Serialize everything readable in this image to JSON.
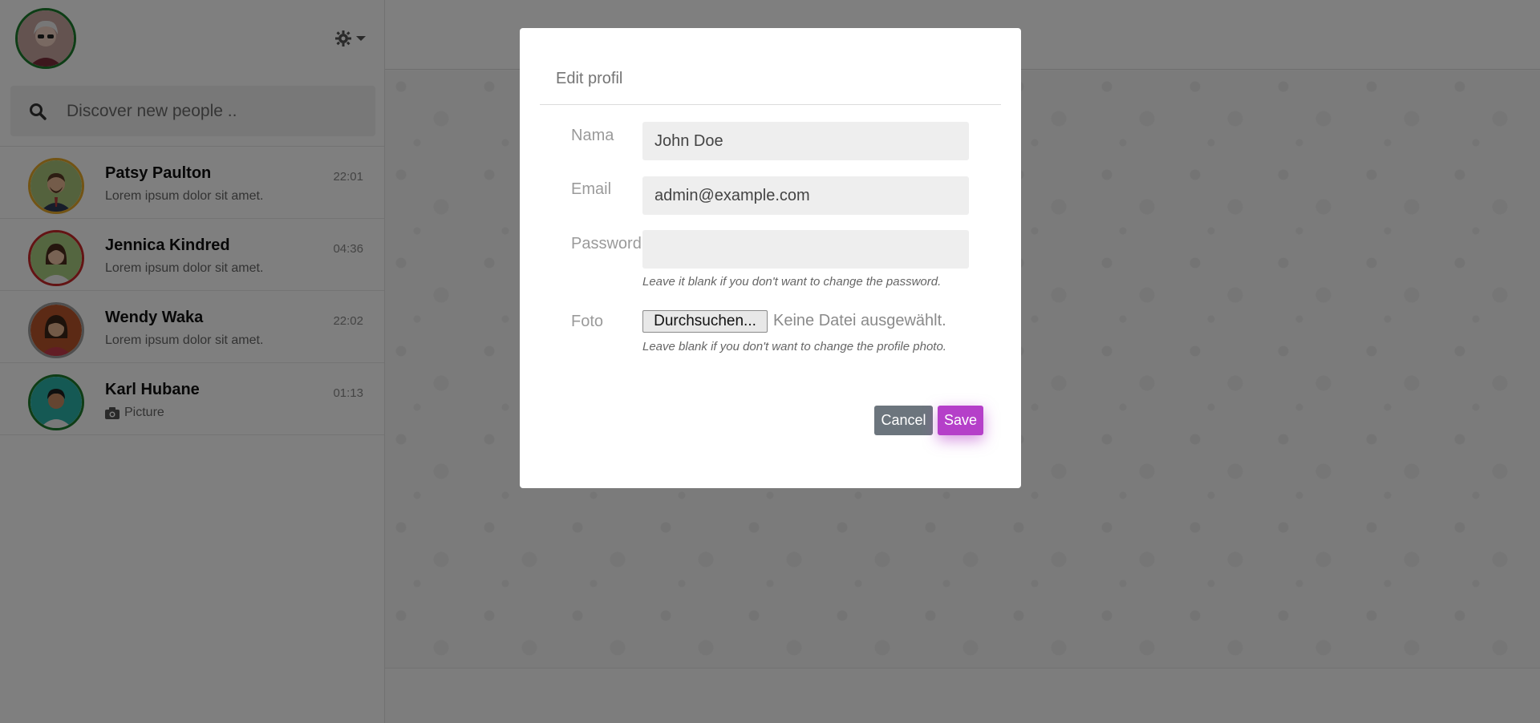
{
  "sidebar": {
    "search": {
      "placeholder": "Discover new people .."
    },
    "contacts": [
      {
        "name": "Patsy Paulton",
        "message": "Lorem ipsum dolor sit amet.",
        "time": "22:01",
        "ring_color": "#e5a92a"
      },
      {
        "name": "Jennica Kindred",
        "message": "Lorem ipsum dolor sit amet.",
        "time": "04:36",
        "ring_color": "#c62828"
      },
      {
        "name": "Wendy Waka",
        "message": "Lorem ipsum dolor sit amet.",
        "time": "22:02",
        "ring_color": "#9e9e9e"
      },
      {
        "name": "Karl Hubane",
        "message": "Picture",
        "message_icon": "camera-icon",
        "time": "01:13",
        "ring_color": "#1d7a2c"
      }
    ],
    "self_ring_color": "#1d7a2c"
  },
  "modal": {
    "title": "Edit profil",
    "fields": {
      "name": {
        "label": "Nama",
        "value": "John Doe"
      },
      "email": {
        "label": "Email",
        "value": "admin@example.com"
      },
      "password": {
        "label": "Password",
        "value": "",
        "help": "Leave it blank if you don't want to change the password."
      },
      "photo": {
        "label": "Foto",
        "button": "Durchsuchen...",
        "status": "Keine Datei ausgewählt.",
        "help": "Leave blank if you don't want to change the profile photo."
      }
    },
    "cancel_label": "Cancel",
    "save_label": "Save",
    "save_color": "#b53fc9"
  }
}
